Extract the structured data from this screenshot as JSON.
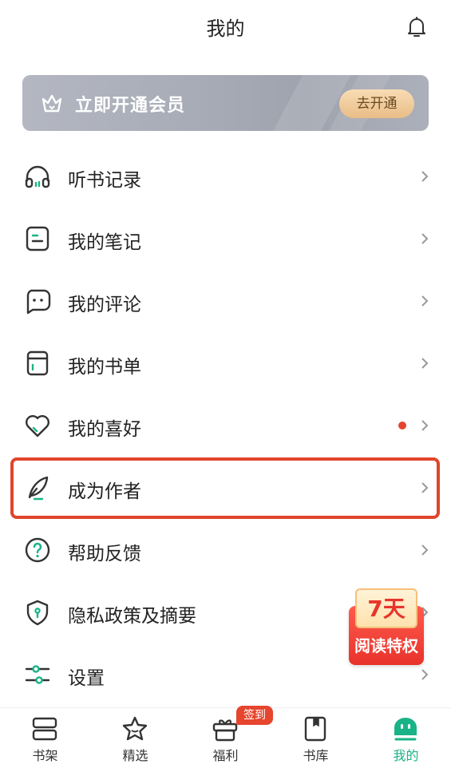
{
  "header": {
    "title": "我的"
  },
  "vip": {
    "label": "立即开通会员",
    "button": "去开通"
  },
  "menu": [
    {
      "label": "听书记录"
    },
    {
      "label": "我的笔记"
    },
    {
      "label": "我的评论"
    },
    {
      "label": "我的书单"
    },
    {
      "label": "我的喜好",
      "unread": true
    },
    {
      "label": "成为作者",
      "highlighted": true
    },
    {
      "label": "帮助反馈"
    },
    {
      "label": "隐私政策及摘要"
    },
    {
      "label": "设置"
    }
  ],
  "promo": {
    "days": "7天",
    "text": "阅读特权"
  },
  "tabbar": {
    "tabs": [
      {
        "label": "书架"
      },
      {
        "label": "精选"
      },
      {
        "label": "福利",
        "badge": "签到"
      },
      {
        "label": "书库"
      },
      {
        "label": "我的",
        "active": true
      }
    ]
  },
  "colors": {
    "accent": "#19b387",
    "highlight_border": "#e0452c",
    "badge": "#e6452e"
  }
}
